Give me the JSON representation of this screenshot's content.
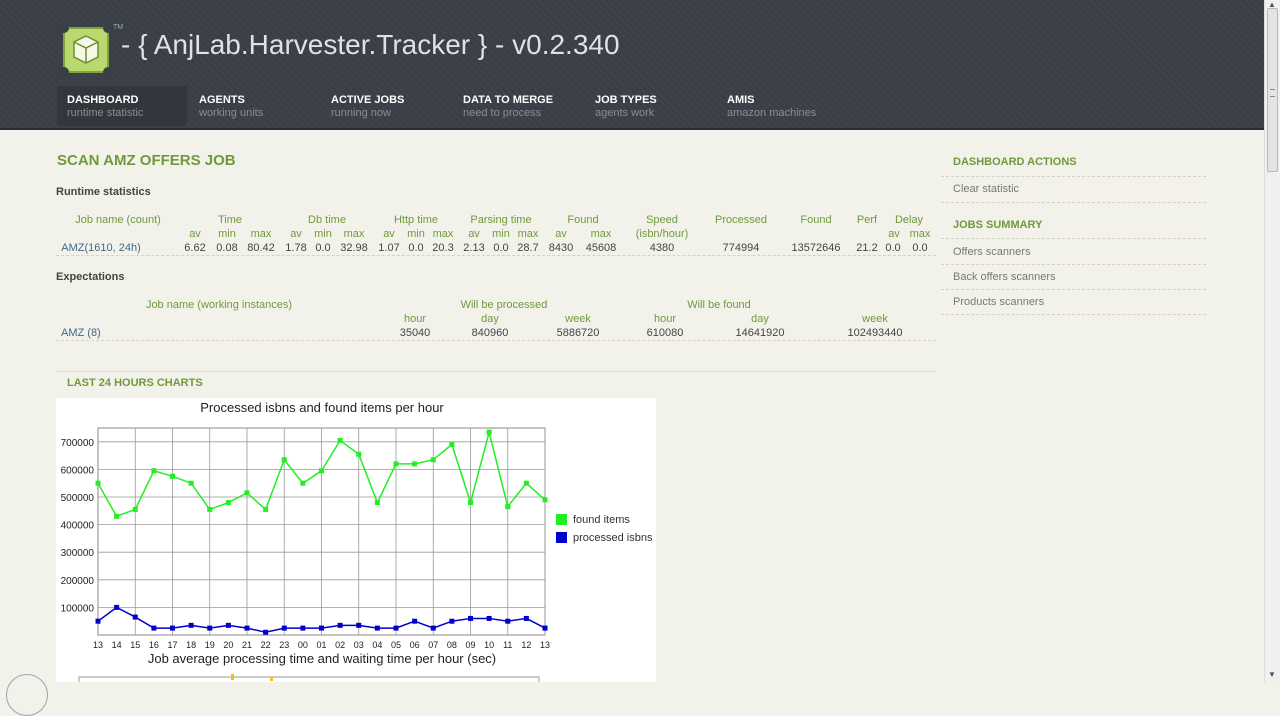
{
  "header": {
    "title": "- { AnjLab.Harvester.Tracker } - v0.2.340",
    "tm": "TM",
    "nav": [
      {
        "label": "DASHBOARD",
        "sub": "runtime statistic"
      },
      {
        "label": "AGENTS",
        "sub": "working units"
      },
      {
        "label": "ACTIVE JOBS",
        "sub": "running now"
      },
      {
        "label": "DATA TO MERGE",
        "sub": "need to process"
      },
      {
        "label": "JOB TYPES",
        "sub": "agents work"
      },
      {
        "label": "AMIS",
        "sub": "amazon machines"
      }
    ],
    "active_index": 0
  },
  "main": {
    "title": "SCAN AMZ OFFERS JOB",
    "runtime": {
      "heading": "Runtime statistics",
      "headers": {
        "job": "Job name (count)",
        "time": "Time",
        "db": "Db time",
        "http": "Http time",
        "parsing": "Parsing time",
        "found": "Found",
        "speed": "Speed",
        "speed_unit": "(isbn/hour)",
        "processed": "Processed",
        "found2": "Found",
        "perf": "Perf",
        "delay": "Delay"
      },
      "sub": {
        "av": "av",
        "min": "min",
        "max": "max"
      },
      "row": {
        "job": "AMZ(1610, 24h)",
        "time_av": "6.62",
        "time_min": "0.08",
        "time_max": "80.42",
        "db_av": "1.78",
        "db_min": "0.0",
        "db_max": "32.98",
        "http_av": "1.07",
        "http_min": "0.0",
        "http_max": "20.3",
        "pars_av": "2.13",
        "pars_min": "0.0",
        "pars_max": "28.7",
        "found_av": "8430",
        "found_max": "45608",
        "speed": "4380",
        "processed": "774994",
        "found_total": "13572646",
        "perf": "21.2",
        "delay_av": "0.0",
        "delay_max": "0.0"
      }
    },
    "expectations": {
      "heading": "Expectations",
      "headers": {
        "job": "Job name (working instances)",
        "processed": "Will be processed",
        "found": "Will be found",
        "hour": "hour",
        "day": "day",
        "week": "week"
      },
      "row": {
        "job": "AMZ (8)",
        "p_hour": "35040",
        "p_day": "840960",
        "p_week": "5886720",
        "f_hour": "610080",
        "f_day": "14641920",
        "f_week": "102493440"
      }
    },
    "charts": {
      "heading": "LAST 24 HOURS CHARTS",
      "next_title": "Job average processing time and waiting time per hour (sec)"
    }
  },
  "sidebar": {
    "actions_title": "DASHBOARD ACTIONS",
    "actions": [
      "Clear statistic"
    ],
    "summary_title": "JOBS SUMMARY",
    "summary": [
      "Offers scanners",
      "Back offers scanners",
      "Products scanners"
    ]
  },
  "colors": {
    "accent": "#6e9a3c",
    "header_bg": "#3a3e46",
    "found_series": "#22ee22",
    "processed_series": "#0000cc"
  },
  "chart_data": {
    "type": "line",
    "title": "Processed isbns and found items per hour",
    "xlabel": "",
    "ylabel": "",
    "categories": [
      "13",
      "14",
      "15",
      "16",
      "17",
      "18",
      "19",
      "20",
      "21",
      "22",
      "23",
      "00",
      "01",
      "02",
      "03",
      "04",
      "05",
      "06",
      "07",
      "08",
      "09",
      "10",
      "11",
      "12",
      "13"
    ],
    "ylim": [
      0,
      750000
    ],
    "yticks": [
      100000,
      200000,
      300000,
      400000,
      500000,
      600000,
      700000
    ],
    "grid": true,
    "legend": "right",
    "series": [
      {
        "name": "found items",
        "color": "#22ee22",
        "values": [
          550000,
          430000,
          455000,
          595000,
          575000,
          550000,
          455000,
          480000,
          515000,
          455000,
          635000,
          550000,
          595000,
          705000,
          655000,
          480000,
          620000,
          620000,
          635000,
          690000,
          480000,
          735000,
          465000,
          550000,
          490000
        ]
      },
      {
        "name": "processed isbns",
        "color": "#0000cc",
        "values": [
          50000,
          100000,
          65000,
          25000,
          25000,
          35000,
          25000,
          35000,
          25000,
          10000,
          25000,
          25000,
          25000,
          35000,
          35000,
          25000,
          25000,
          50000,
          25000,
          50000,
          60000,
          60000,
          50000,
          60000,
          25000
        ]
      }
    ]
  }
}
